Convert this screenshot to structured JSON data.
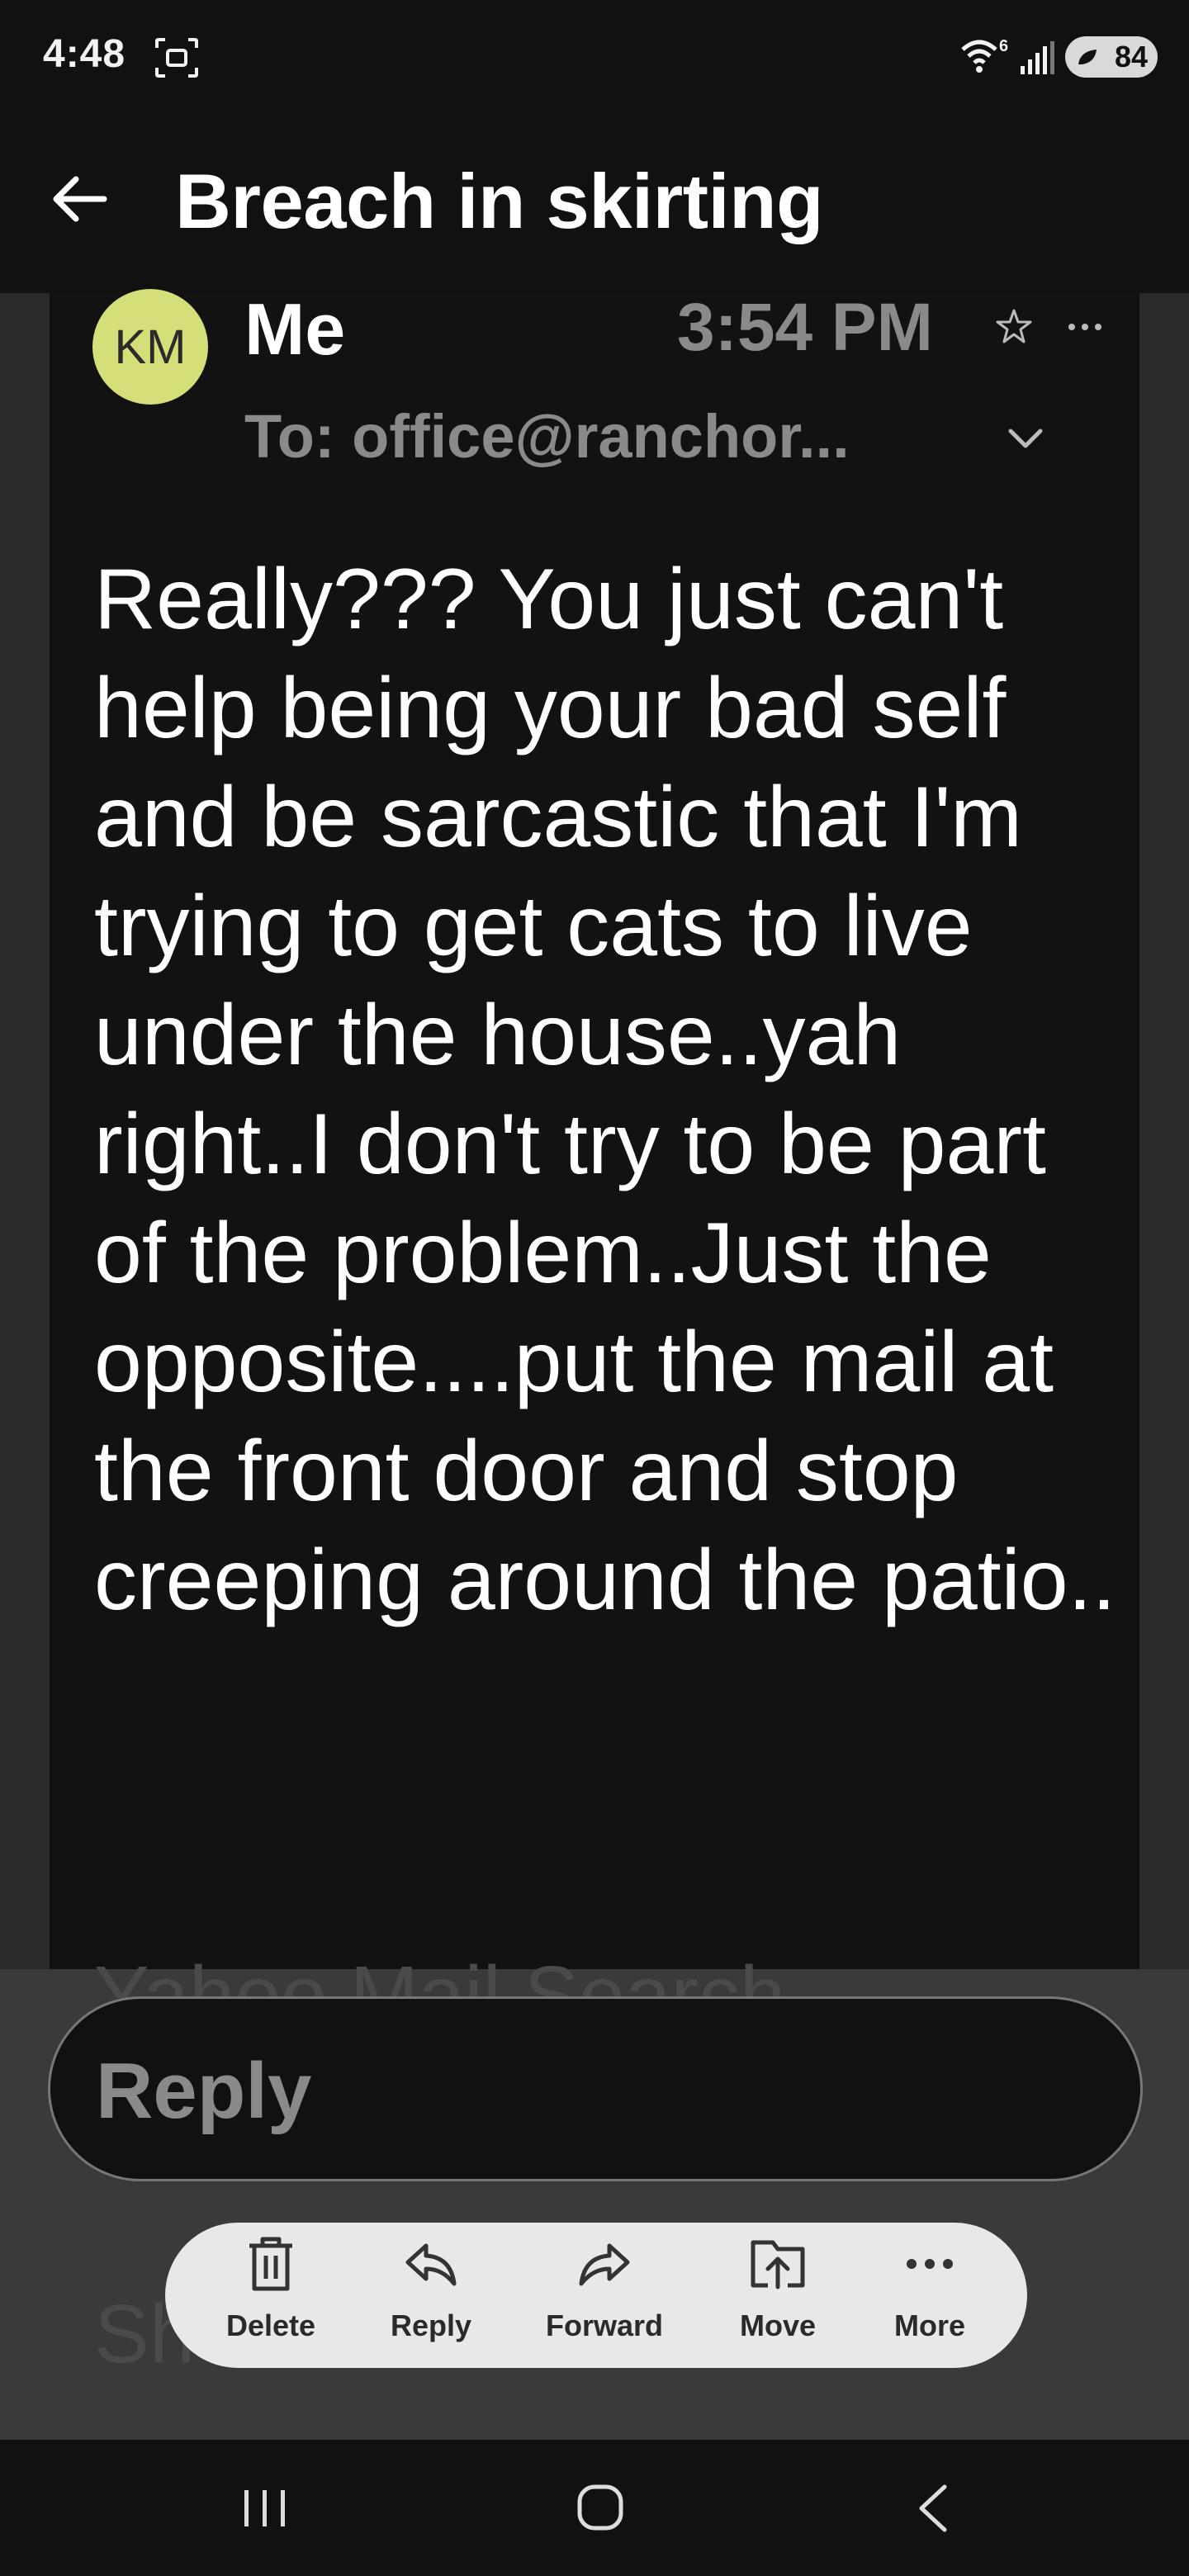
{
  "status_bar": {
    "time": "4:48",
    "network_badge": "6",
    "battery": "84"
  },
  "header": {
    "title": "Breach in skirting"
  },
  "message": {
    "avatar_initials": "KM",
    "sender": "Me",
    "time": "3:54 PM",
    "recipient": "To: office@ranchor...",
    "body": "Really??? You just can't help being your bad self and be sarcastic that I'm trying to get cats to live under the house..yah right..I don't try to be part of the problem..Just the opposite....put the mail at the front door and stop creeping around the patio.."
  },
  "ghost": {
    "line1": "Yahoo Mail Search",
    "line2": "Sh"
  },
  "reply": {
    "placeholder": "Reply"
  },
  "actions": [
    {
      "label": "Delete",
      "icon": "trash-icon"
    },
    {
      "label": "Reply",
      "icon": "reply-icon"
    },
    {
      "label": "Forward",
      "icon": "forward-icon"
    },
    {
      "label": "Move",
      "icon": "move-icon"
    },
    {
      "label": "More",
      "icon": "more-icon"
    }
  ],
  "colors": {
    "background": "#111111",
    "avatar": "#d6de7a",
    "muted_text": "#8a8a8a",
    "action_bar": "#e8e8e8"
  }
}
